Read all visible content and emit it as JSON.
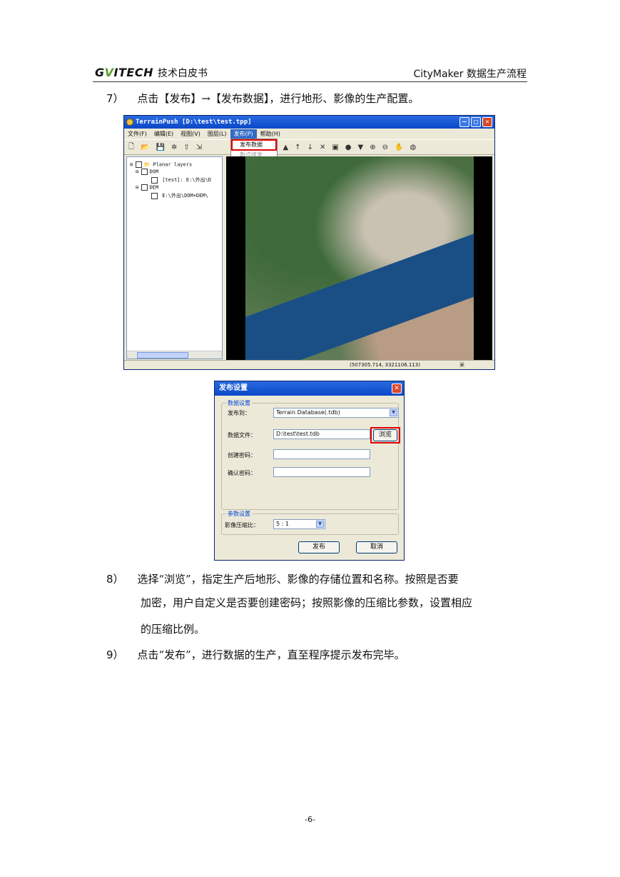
{
  "header": {
    "logo_text": "G",
    "logo_v": "V",
    "logo_rest": "ITECH",
    "subtitle": "技术白皮书",
    "right_title": "CityMaker 数据生产流程"
  },
  "steps": [
    {
      "num": "7）",
      "text": "点击【发布】→【发布数据】，进行地形、影像的生产配置。"
    },
    {
      "num": "8）",
      "line1": "选择“浏览”，指定生产后地形、影像的存储位置和名称。按照是否要",
      "line2": "加密，用户自定义是否要创建密码；按照影像的压缩比参数，设置相应",
      "line3": "的压缩比例。"
    },
    {
      "num": "9）",
      "text": "点击“发布”，进行数据的生产，直至程序提示发布完毕。"
    }
  ],
  "app": {
    "title": "TerrainPush   [D:\\test\\test.tpp]",
    "menu": [
      "文件(F)",
      "编辑(E)",
      "视图(V)",
      "图层(L)",
      "发布(P)",
      "帮助(H)"
    ],
    "dropdown": [
      "发布数据",
      "断点续发"
    ],
    "tree": {
      "root": "Planar layers",
      "dom": "DOM",
      "dom_item": "[test]: E:\\外出\\D",
      "dem": "DEM",
      "dem_item": "E:\\外出\\DOM+DEM\\"
    },
    "status_coord": "(507305.714,  3321106.113)",
    "status_unit": "米"
  },
  "dialog": {
    "title": "发布设置",
    "group1": "数据设置",
    "publish_to_label": "发布到：",
    "publish_to_value": "Terrain Database(.tdb)",
    "data_file_label": "数据文件：",
    "data_file_value": "D:\\test\\test.tdb",
    "browse": "浏览",
    "create_pwd_label": "创建密码：",
    "confirm_pwd_label": "确认密码：",
    "group2": "参数设置",
    "compress_label": "影像压缩比：",
    "compress_value": "5 : 1",
    "publish_btn": "发布",
    "cancel_btn": "取消"
  },
  "page_number": "-6-"
}
